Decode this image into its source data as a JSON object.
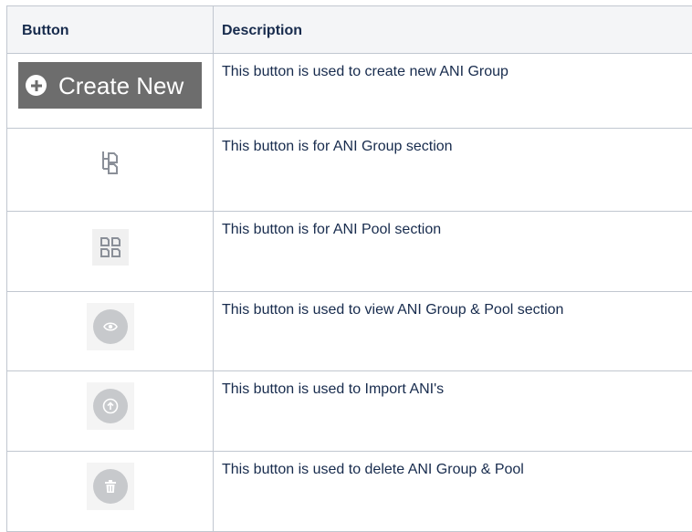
{
  "table": {
    "headers": {
      "button": "Button",
      "description": "Description"
    },
    "rows": [
      {
        "button_label": "Create New",
        "button_icon": "plus-circle-icon",
        "description": "This button is used to create new ANI Group"
      },
      {
        "button_icon": "ani-group-icon",
        "description": "This button is for ANI Group section"
      },
      {
        "button_icon": "ani-pool-icon",
        "description": "This button is for ANI Pool section"
      },
      {
        "button_icon": "eye-icon",
        "description": "This button is used to view ANI Group & Pool section"
      },
      {
        "button_icon": "upload-icon",
        "description": "This button is used to Import ANI's"
      },
      {
        "button_icon": "trash-icon",
        "description": "This button is used to delete ANI Group & Pool"
      }
    ]
  },
  "colors": {
    "header_bg": "#f4f5f7",
    "border": "#c1c7d0",
    "create_button_bg": "#6d6d6d",
    "icon_gray": "#8a8f98",
    "circle_bg": "#c7c9cc"
  }
}
